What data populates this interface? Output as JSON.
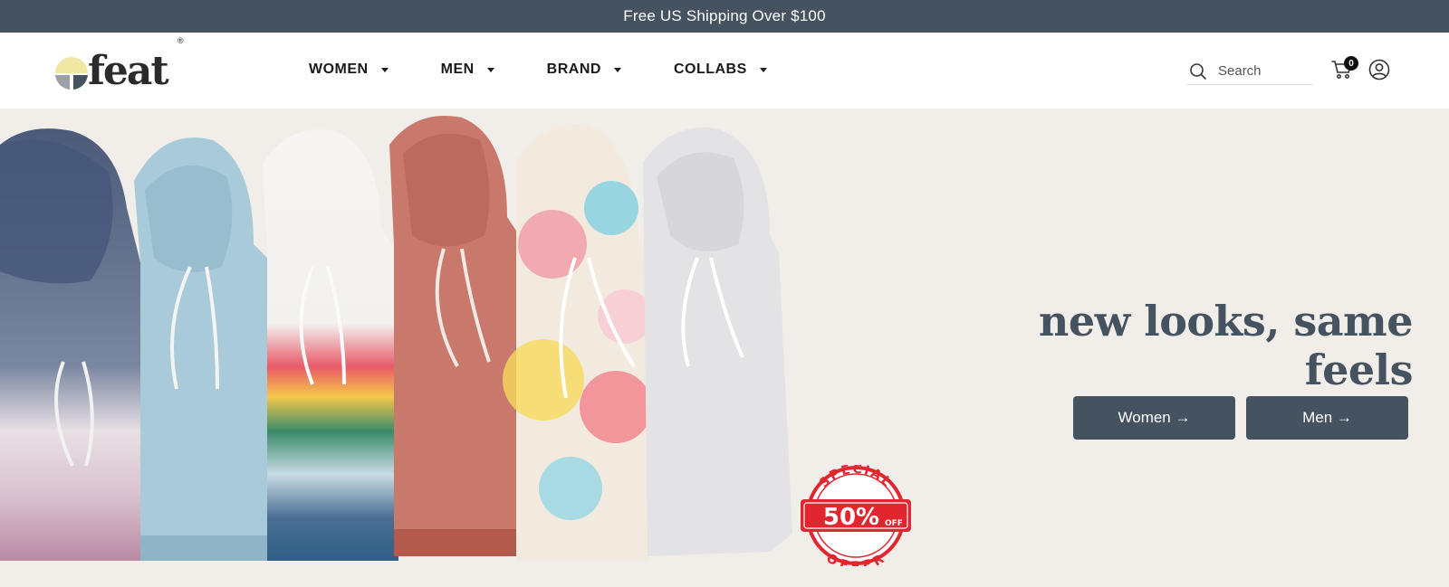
{
  "announcement": {
    "text": "Free US Shipping Over $100"
  },
  "brand": {
    "name": "feat",
    "mark": "®"
  },
  "nav": {
    "items": [
      {
        "label": "WOMEN"
      },
      {
        "label": "MEN"
      },
      {
        "label": "BRAND"
      },
      {
        "label": "COLLABS"
      }
    ]
  },
  "search": {
    "placeholder": "Search"
  },
  "cart": {
    "count": "0"
  },
  "hero": {
    "headline": "new looks, same feels",
    "buttons": {
      "women": "Women →",
      "men": "Men →"
    },
    "stamp": {
      "top": "SPECIAL",
      "value": "50%",
      "off": "OFF",
      "bottom": "OFFER"
    }
  },
  "colors": {
    "slate": "#45525f",
    "background": "#f1eee9",
    "stamp_red": "#e1262f"
  },
  "icons": [
    "logo-icon",
    "caret-down-icon",
    "search-icon",
    "cart-icon",
    "account-icon"
  ]
}
